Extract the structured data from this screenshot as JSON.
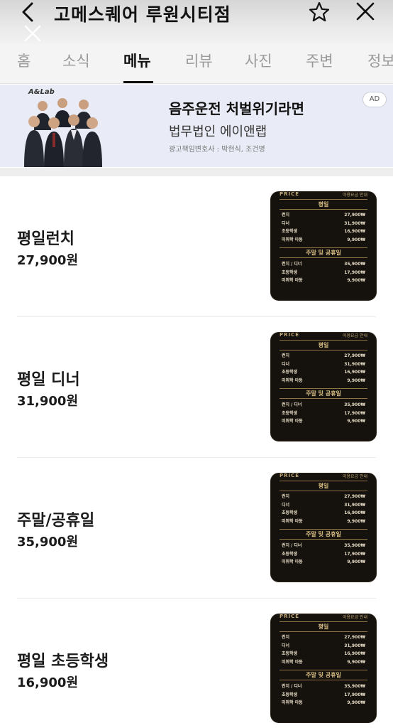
{
  "header": {
    "store_title": "고메스퀘어 루원시티점"
  },
  "tabs": [
    {
      "label": "홈"
    },
    {
      "label": "소식"
    },
    {
      "label": "메뉴"
    },
    {
      "label": "리뷰"
    },
    {
      "label": "사진"
    },
    {
      "label": "주변"
    },
    {
      "label": "정보"
    }
  ],
  "active_tab": "메뉴",
  "ad": {
    "logo": "A&Lab",
    "headline": "음주운전 처벌위기라면",
    "sub": "법무법인 에이앤랩",
    "caption": "광고책임변호사 : 박현식, 조건명",
    "badge": "AD"
  },
  "price_board": {
    "top_left": "PRICE",
    "top_right": "이용요금 안내",
    "weekday_label": "평일",
    "weekday_rows": [
      {
        "name": "런치",
        "price": "27,900₩"
      },
      {
        "name": "디너",
        "price": "31,900₩"
      },
      {
        "name": "초등학생",
        "price": "16,900₩"
      },
      {
        "name": "미취학 아동",
        "price": "9,900₩"
      }
    ],
    "weekend_label": "주말 및 공휴일",
    "weekend_rows": [
      {
        "name": "런치 / 디너",
        "price": "35,900₩"
      },
      {
        "name": "초등학생",
        "price": "17,900₩"
      },
      {
        "name": "미취학 아동",
        "price": "9,900₩"
      }
    ]
  },
  "menu_items": [
    {
      "name": "평일런치",
      "price": "27,900원"
    },
    {
      "name": "평일 디너",
      "price": "31,900원"
    },
    {
      "name": "주말/공휴일",
      "price": "35,900원"
    },
    {
      "name": "평일 초등학생",
      "price": "16,900원"
    }
  ],
  "colors": {
    "active_tab": "#111111",
    "inactive_tab": "#9a9a9a",
    "ad_background": "#e9ecf6",
    "price_board_bg": "#15110c",
    "price_board_gold": "#d9bf86"
  }
}
